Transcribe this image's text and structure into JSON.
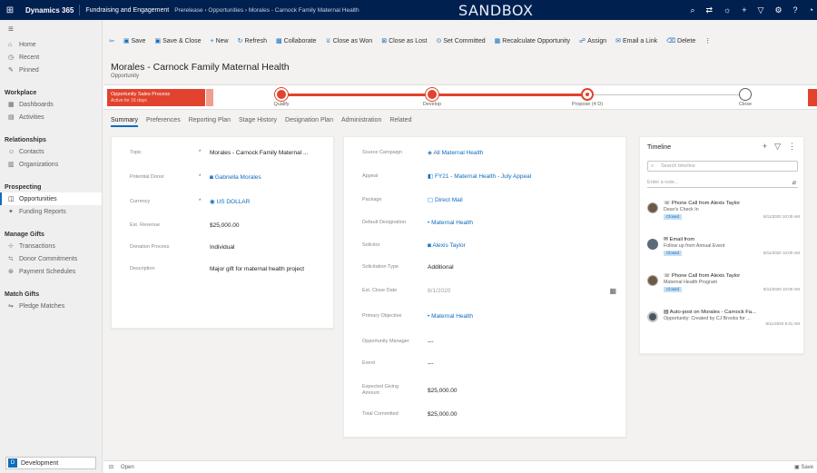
{
  "topbar": {
    "app": "Dynamics 365",
    "area": "Fundraising and Engagement",
    "crumbs": "Prerelease › Opportunities › Morales - Carnock Family Maternal Health",
    "env": "SANDBOX"
  },
  "nav": {
    "home": "Home",
    "recent": "Recent",
    "pinned": "Pinned",
    "workplace": "Workplace",
    "dashboards": "Dashboards",
    "activities": "Activities",
    "relationships": "Relationships",
    "contacts": "Contacts",
    "organizations": "Organizations",
    "prospecting": "Prospecting",
    "opportunities": "Opportunities",
    "funding_reports": "Funding Reports",
    "manage_gifts": "Manage Gifts",
    "transactions": "Transactions",
    "donor_commitments": "Donor Commitments",
    "payment_schedules": "Payment Schedules",
    "match_gifts": "Match Gifts",
    "pledge_matches": "Pledge Matches",
    "area_switcher": "Development",
    "area_badge": "D"
  },
  "commands": [
    "Save",
    "Save & Close",
    "New",
    "Refresh",
    "Collaborate",
    "Close as Won",
    "Close as Lost",
    "Set Committed",
    "Recalculate Opportunity",
    "Assign",
    "Email a Link",
    "Delete"
  ],
  "record": {
    "title": "Morales - Carnock Family Maternal Health",
    "entity": "Opportunity"
  },
  "bpf": {
    "flag_title": "Opportunity Sales Process",
    "flag_sub": "Active for 16 days",
    "stages": [
      "Qualify",
      "Develop",
      "Propose (4 D)",
      "Close"
    ]
  },
  "tabs": [
    "Summary",
    "Preferences",
    "Reporting Plan",
    "Stage History",
    "Designation Plan",
    "Administration",
    "Related"
  ],
  "left_fields": [
    {
      "label": "Topic",
      "value": "Morales - Carnock Family Maternal ..."
    },
    {
      "label": "Potential Donor",
      "value": "Gabriella Morales"
    },
    {
      "label": "Currency",
      "value": "US DOLLAR"
    },
    {
      "label": "Est. Revenue",
      "value": "$25,000.00"
    },
    {
      "label": "Donation Process",
      "value": "Individual"
    },
    {
      "label": "Description",
      "value": "Major gift for maternal health project"
    }
  ],
  "mid_fields": [
    {
      "label": "Source Campaign",
      "value": "All Maternal Health"
    },
    {
      "label": "Appeal",
      "value": "FY21 - Maternal Health - July Appeal"
    },
    {
      "label": "Package",
      "value": "Direct Mail"
    },
    {
      "label": "Default Designation",
      "value": "Maternal Health"
    },
    {
      "label": "Solicitor",
      "value": "Alexis Taylor"
    },
    {
      "label": "Solicitation Type",
      "value": "Additional"
    },
    {
      "label": "Est. Close Date",
      "value": "8/1/2020"
    },
    {
      "label": "Primary Objective",
      "value": "Maternal Health"
    },
    {
      "label": "Opportunity Manager",
      "value": "---"
    },
    {
      "label": "Event",
      "value": "---"
    },
    {
      "label": "Expected Giving Amount",
      "value": "$25,000.00"
    },
    {
      "label": "Total Committed",
      "value": "$25,000.00"
    }
  ],
  "timeline": {
    "title": "Timeline",
    "search": "Search timeline",
    "note": "Enter a note...",
    "items": [
      {
        "t1": "Phone Call from Alexis Taylor",
        "t2": "Dean's Check In",
        "chip": "Closed",
        "dt": "8/11/2020 10:00 AM"
      },
      {
        "t1": "Email from",
        "t2": "Follow up from Annual Event",
        "chip": "Closed",
        "dt": "8/11/2020 10:00 AM"
      },
      {
        "t1": "Phone Call from Alexis Taylor",
        "t2": "Maternal Health Program",
        "chip": "Closed",
        "dt": "8/11/2020 10:00 AM"
      },
      {
        "t1": "Auto-post on Morales - Carnock Fa...",
        "t2": "Opportunity: Created by CJ Brooks for ...",
        "chip": "",
        "dt": "8/11/2020 9:31 AM"
      }
    ]
  },
  "status": {
    "left": "Open",
    "right": "Save"
  }
}
